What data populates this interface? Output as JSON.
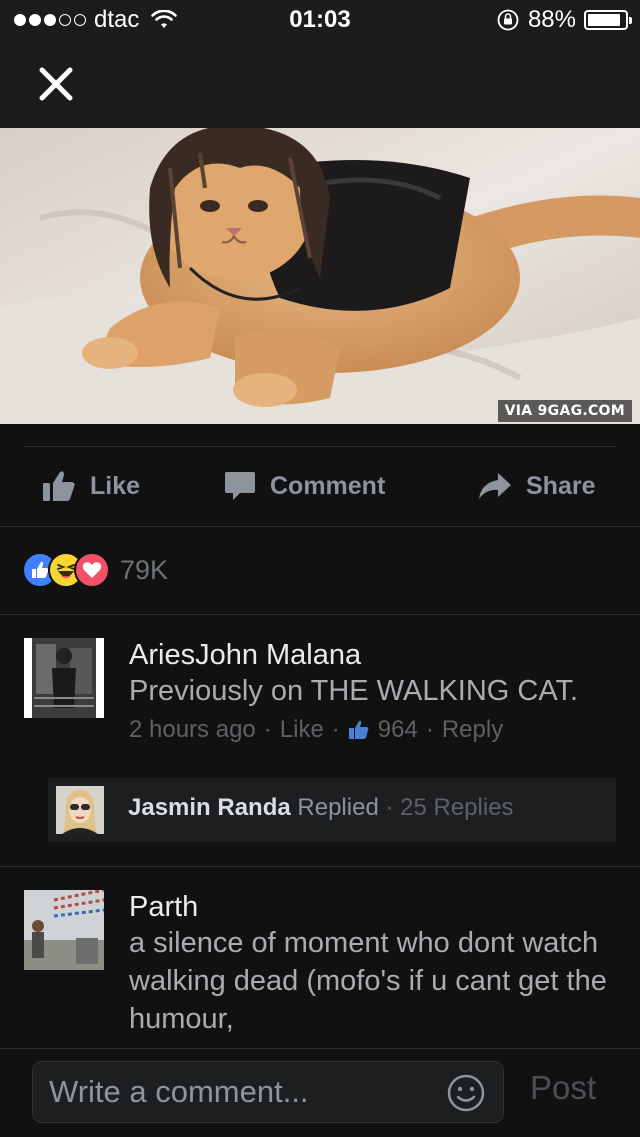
{
  "status_bar": {
    "carrier": "dtac",
    "signal_bars_filled": 3,
    "signal_bars_total": 5,
    "time": "01:03",
    "battery": "88%",
    "battery_level": 0.88
  },
  "header": {
    "close_icon": "close-icon"
  },
  "photo": {
    "watermark": "VIA 9GAG.COM"
  },
  "actions": {
    "like": "Like",
    "comment": "Comment",
    "share": "Share"
  },
  "reactions": {
    "icons": [
      "like-reaction-icon",
      "haha-reaction-icon",
      "love-reaction-icon"
    ],
    "count": "79K"
  },
  "comments": [
    {
      "author": "AriesJohn Malana",
      "body": "Previously on THE WALKING CAT.",
      "time": "2 hours ago",
      "like_label": "Like",
      "like_count": "964",
      "reply_label": "Reply"
    },
    {
      "author": "Parth",
      "body": "a silence of moment who dont watch walking dead (mofo's if u cant get the humour,"
    }
  ],
  "reply_preview": {
    "name": "Jasmin Randa",
    "action": "Replied",
    "separator": "·",
    "count": "25 Replies"
  },
  "composer": {
    "placeholder": "Write a comment...",
    "post_label": "Post"
  },
  "colors": {
    "background": "#111111",
    "bar": "#1c1c1c",
    "accent_like": "#4080ff",
    "love": "#f25268",
    "haha": "#f7d633"
  }
}
